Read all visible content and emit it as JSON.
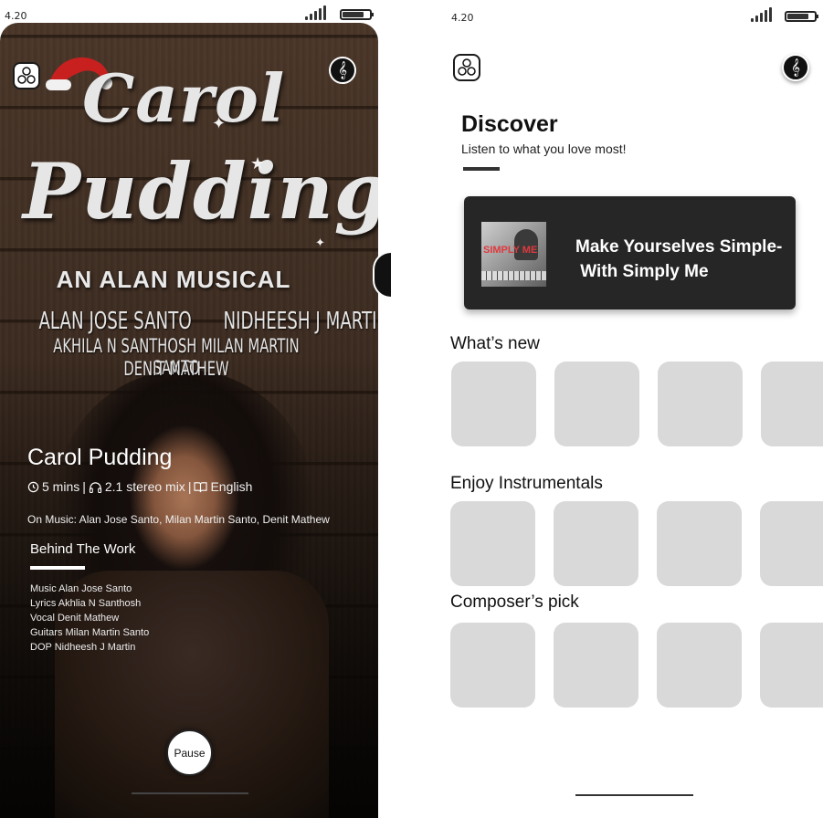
{
  "status_bar": {
    "time_left": "4.20",
    "time_right": "4.20"
  },
  "now_playing": {
    "poster": {
      "title_line1": "Carol",
      "title_line2": "Pudding",
      "subtitle": "AN ALAN MUSICAL",
      "credits": [
        "ALAN JOSE SANTO      NIDHEESH J MARTIN",
        "AKHILA N SANTHOSH MILAN MARTIN SANTO",
        "DENIT MATHEW"
      ]
    },
    "title": "Carol Pudding",
    "duration": "5 mins",
    "audio": "2.1 stereo mix",
    "language": "English",
    "separator": "|",
    "on_music": "On Music: Alan Jose Santo, Milan Martin Santo, Denit Mathew",
    "behind_title": "Behind The Work",
    "behind_items": [
      "Music Alan Jose Santo",
      "Lyrics Akhlia N Santhosh",
      "Vocal Denit Mathew",
      "Guitars Milan Martin Santo",
      "DOP Nidheesh J Martin"
    ],
    "pause_label": "Pause"
  },
  "discover": {
    "title": "Discover",
    "subtitle": "Listen to what you love most!",
    "featured": {
      "title_line1": "Make Yourselves Simple-",
      "title_line2": " With Simply Me",
      "thumb_text": "SIMPLY ME"
    },
    "sections": [
      {
        "title": "What’s new"
      },
      {
        "title": "Enjoy Instrumentals"
      },
      {
        "title": "Composer’s pick"
      }
    ]
  },
  "icons": {
    "menu": "circles-menu-icon",
    "music": "music-note-icon",
    "clock": "clock-icon",
    "headphones": "headphones-icon",
    "book": "book-icon"
  },
  "colors": {
    "card_bg": "#262626",
    "tile_bg": "#d9d9d9"
  }
}
